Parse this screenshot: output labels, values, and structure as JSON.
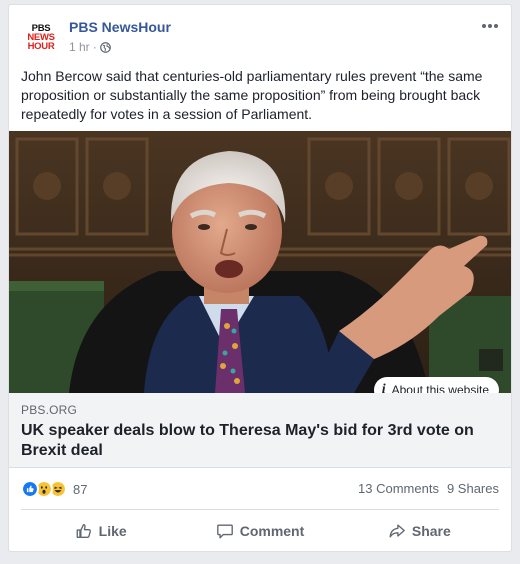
{
  "post": {
    "page_name": "PBS NewsHour",
    "logo_lines": [
      "PBS",
      "NEWS",
      "HOUR"
    ],
    "timestamp": "1 hr",
    "separator": "·",
    "privacy_icon": "globe-icon",
    "more_icon": "more-options-icon",
    "message": "John Bercow said that centuries-old parliamentary rules prevent “the same proposition or substantially the same proposition” from being brought back repeatedly for votes in a session of Parliament."
  },
  "link": {
    "about_icon": "i",
    "about_label": "About this website",
    "domain": "PBS.ORG",
    "headline": "UK speaker deals blow to Theresa May's bid for 3rd vote on Brexit deal"
  },
  "stats": {
    "reaction_icons": [
      "like-reaction-icon",
      "wow-reaction-icon",
      "haha-reaction-icon"
    ],
    "reaction_count": "87",
    "comments": "13 Comments",
    "shares": "9 Shares"
  },
  "actions": {
    "like": "Like",
    "comment": "Comment",
    "share": "Share"
  },
  "colors": {
    "link_blue": "#365899",
    "pbs_red": "#e0201b",
    "like_blue": "#1877f2",
    "reaction_yellow": "#f7c336"
  }
}
